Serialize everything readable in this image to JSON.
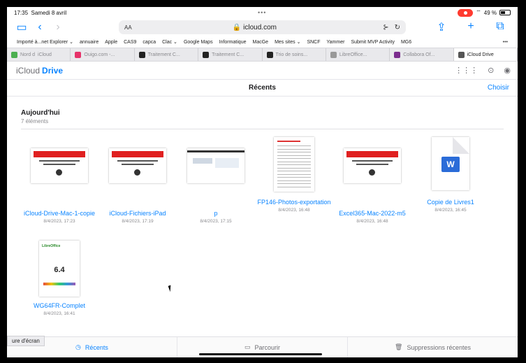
{
  "status": {
    "time": "17:35",
    "date": "Samedi 8 avril",
    "dots": "•••",
    "battery": "49 %"
  },
  "toolbar": {
    "aa": "AA",
    "url": "icloud.com",
    "lock": "🔒"
  },
  "favorites": [
    "Importé à...net Explorer ⌄",
    "annuaire",
    "Apple",
    "CAS9",
    "capca",
    "Clac ⌄",
    "Google Maps",
    "Informatique",
    "MacGe",
    "Mes sites ⌄",
    "SNCF",
    "Yammer",
    "Submit MVP Activity",
    "MG6"
  ],
  "favorites_more": "•••",
  "tabs": [
    {
      "label": "Nord d",
      "extra": "iCloud",
      "icon_color": "#4caf50",
      "active": false
    },
    {
      "label": "Ouigo.com -...",
      "icon_color": "#e6336a",
      "active": false
    },
    {
      "label": "Traitement C...",
      "icon_color": "#222222",
      "active": false
    },
    {
      "label": "Traitement C...",
      "icon_color": "#222222",
      "active": false
    },
    {
      "label": "Trio de soins...",
      "icon_color": "#222222",
      "active": false
    },
    {
      "label": "LibreOffice...",
      "icon_color": "#999999",
      "active": false
    },
    {
      "label": "Collabora Of...",
      "icon_color": "#7b2d8e",
      "active": false
    },
    {
      "label": "iCloud Drive",
      "icon_color": "#555555",
      "active": true
    }
  ],
  "icloud": {
    "brand": "iCloud",
    "product": "Drive",
    "section_title": "Récents",
    "choose": "Choisir"
  },
  "section": {
    "heading": "Aujourd'hui",
    "count": "7 éléments"
  },
  "files": [
    {
      "name": "iCloud-Drive-Mac-1-copie",
      "date": "8/4/2023, 17:23",
      "kind": "slide"
    },
    {
      "name": "iCloud-Fichiers-iPad",
      "date": "8/4/2023, 17:19",
      "kind": "slide"
    },
    {
      "name": "p",
      "date": "8/4/2023, 17:15",
      "kind": "screenshot"
    },
    {
      "name": "FP146-Photos-exportation",
      "date": "8/4/2023, 16:48",
      "kind": "doc"
    },
    {
      "name": "Excel365-Mac-2022-m5",
      "date": "8/4/2023, 16:48",
      "kind": "slide"
    },
    {
      "name": "Copie de Livres1",
      "date": "8/4/2023, 16:45",
      "kind": "word"
    },
    {
      "name": "WG64FR-Complet",
      "date": "8/4/2023, 16:41",
      "kind": "lo",
      "thumb_text": "6.4",
      "thumb_logo": "LibreOffice"
    }
  ],
  "bottom": {
    "recents": "Récents",
    "browse": "Parcourir",
    "deleted": "Suppressions récentes",
    "tooltip": "ure d'écran"
  }
}
